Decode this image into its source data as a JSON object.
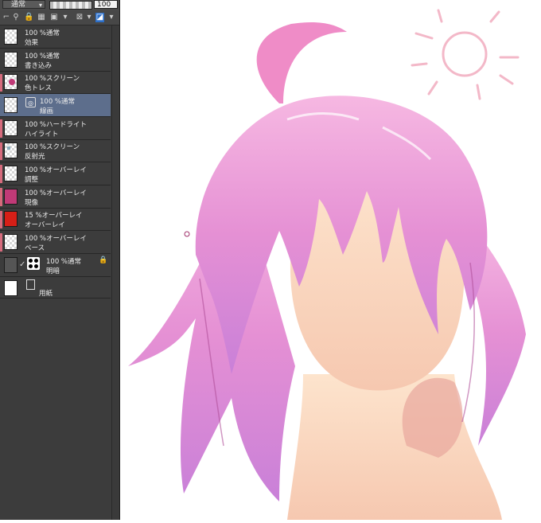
{
  "toolbar": {
    "blend_mode": "通常",
    "opacity": "100"
  },
  "layers": [
    {
      "mode": "100 %通常",
      "name": "効果"
    },
    {
      "mode": "100 %通常",
      "name": "書き込み"
    },
    {
      "mode": "100 %スクリーン",
      "name": "色トレス"
    },
    {
      "mode": "100 %通常",
      "name": "線画"
    },
    {
      "mode": "100 %ハードライト",
      "name": "ハイライト"
    },
    {
      "mode": "100 %スクリーン",
      "name": "反射光"
    },
    {
      "mode": "100 %オーバーレイ",
      "name": "調整"
    },
    {
      "mode": "100 %オーバーレイ",
      "name": "現像"
    },
    {
      "mode": "15 %オーバーレイ",
      "name": "オーバーレイ"
    },
    {
      "mode": "100 %オーバーレイ",
      "name": "ベース"
    },
    {
      "mode": "100 %通常",
      "name": "明暗"
    },
    {
      "mode": "",
      "name": "用紙"
    }
  ],
  "colors": {
    "panel_bg": "#3c3c3c",
    "selected_row": "#5d6e8c",
    "clip_marker": "#d66a7c",
    "hair_pink": "#f2a9d6",
    "skin": "#fde0c6",
    "red_thumb": "#d61f17",
    "magenta_thumb": "#c03a77"
  },
  "icons": {
    "lock": "lock-icon",
    "clip": "clipping-icon",
    "eye": "visibility-icon",
    "folder": "layer-mask-icon"
  }
}
